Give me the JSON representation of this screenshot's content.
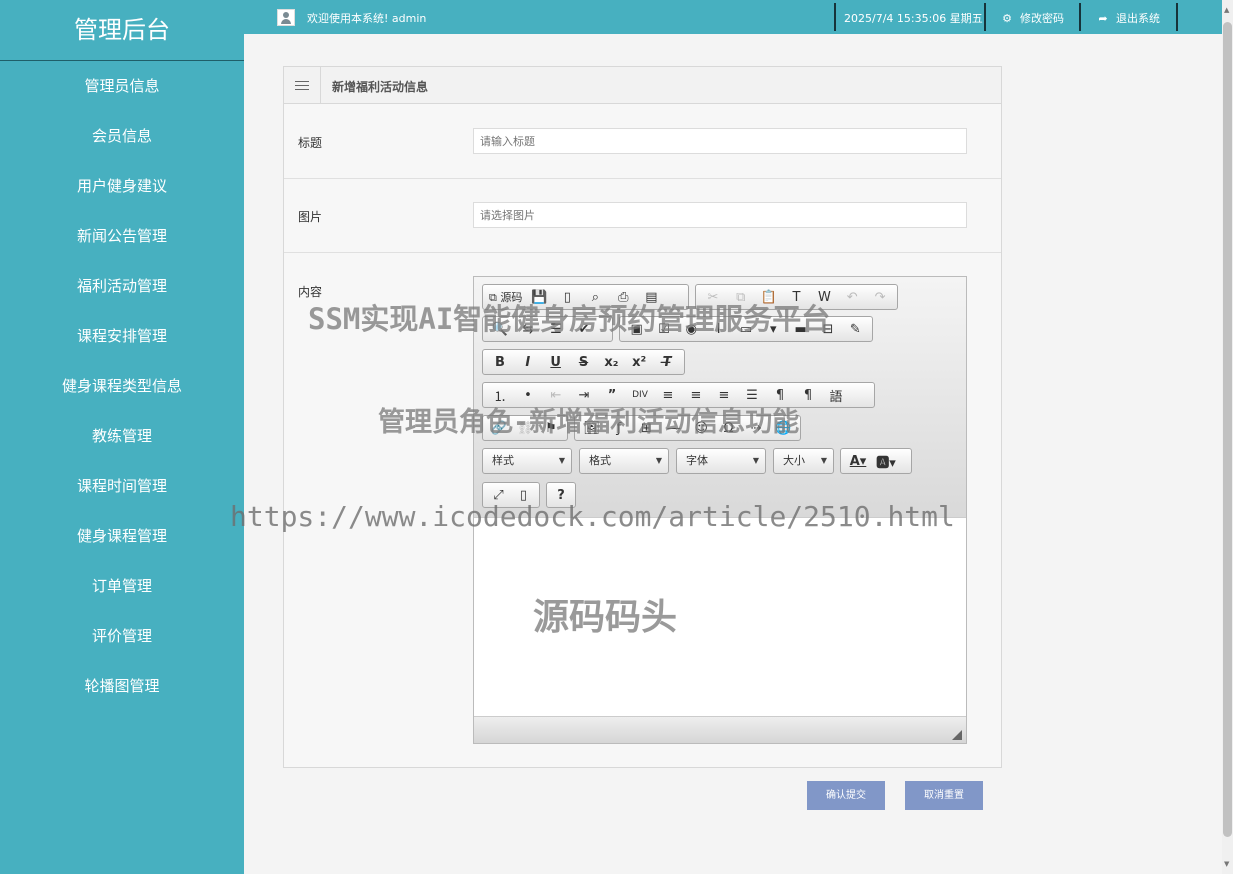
{
  "app": {
    "brand": "管理后台"
  },
  "sidebar": {
    "items": [
      {
        "label": "管理员信息"
      },
      {
        "label": "会员信息"
      },
      {
        "label": "用户健身建议"
      },
      {
        "label": "新闻公告管理"
      },
      {
        "label": "福利活动管理"
      },
      {
        "label": "课程安排管理"
      },
      {
        "label": "健身课程类型信息"
      },
      {
        "label": "教练管理"
      },
      {
        "label": "课程时间管理"
      },
      {
        "label": "健身课程管理"
      },
      {
        "label": "订单管理"
      },
      {
        "label": "评价管理"
      },
      {
        "label": "轮播图管理"
      }
    ]
  },
  "topbar": {
    "welcome": "欢迎使用本系统! admin",
    "datetime": "2025/7/4 15:35:06 星期五",
    "change_password": "修改密码",
    "logout": "退出系统"
  },
  "form": {
    "title": "新增福利活动信息",
    "title_label": "标题",
    "title_placeholder": "请输入标题",
    "image_label": "图片",
    "image_placeholder": "请选择图片",
    "content_label": "内容"
  },
  "editor": {
    "source_label": "源码",
    "style_combo": "样式",
    "format_combo": "格式",
    "font_combo": "字体",
    "size_combo": "大小",
    "help": "?"
  },
  "buttons": {
    "submit": "确认提交",
    "reset": "取消重置"
  },
  "watermarks": {
    "line1": "SSM实现AI智能健身房预约管理服务平台",
    "line2": "管理员角色-新增福利活动信息功能",
    "line3": "https://www.icodedock.com/article/2510.html",
    "line4": "源码码头"
  },
  "colors": {
    "sidebar_bg": "#47b0c0",
    "button_bg": "#8197c8"
  }
}
